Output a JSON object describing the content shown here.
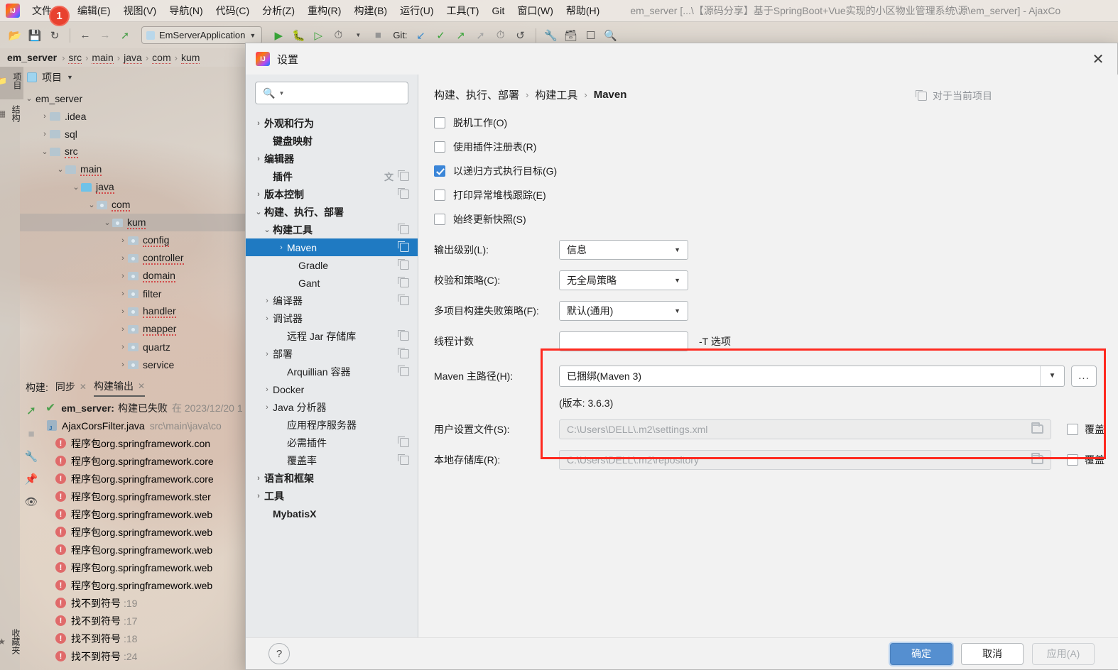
{
  "window": {
    "title": "em_server [...\\【源码分享】基于SpringBoot+Vue实现的小区物业管理系统\\源\\em_server] - AjaxCo",
    "badge": "1"
  },
  "menubar": {
    "items": [
      {
        "label": "文件(F)"
      },
      {
        "label": "编辑(E)"
      },
      {
        "label": "视图(V)"
      },
      {
        "label": "导航(N)"
      },
      {
        "label": "代码(C)"
      },
      {
        "label": "分析(Z)"
      },
      {
        "label": "重构(R)"
      },
      {
        "label": "构建(B)"
      },
      {
        "label": "运行(U)"
      },
      {
        "label": "工具(T)"
      },
      {
        "label": "Git"
      },
      {
        "label": "窗口(W)"
      },
      {
        "label": "帮助(H)"
      }
    ]
  },
  "toolbar": {
    "run_config": "EmServerApplication",
    "git_label": "Git:",
    "icons": [
      "open-icon",
      "save-icon",
      "sync-icon",
      "back-arrow-icon",
      "forward-arrow-icon",
      "build-hammer-icon"
    ],
    "run_icons": [
      "run-icon",
      "debug-icon",
      "run-with-coverage-icon",
      "profile-icon",
      "stop-icon"
    ],
    "git_icons": [
      "update-project-icon",
      "commit-icon",
      "push-icon",
      "rollback-icon",
      "history-icon",
      "undo-icon"
    ],
    "right_icons": [
      "settings-wrench-icon",
      "project-structure-icon",
      "terminal-icon",
      "search-everywhere-icon"
    ]
  },
  "breadcrumb": {
    "root": "em_server",
    "items": [
      "src",
      "main",
      "java",
      "com",
      "kum"
    ],
    "separator": "›"
  },
  "rail": {
    "tabs": [
      {
        "label": "项目",
        "glyph": "folder-icon",
        "active": true
      },
      {
        "label": "结构",
        "glyph": "structure-icon",
        "active": false
      }
    ],
    "bottom": {
      "label": "收藏夹",
      "glyph": "star-icon"
    }
  },
  "project_panel": {
    "title": "项目",
    "tree": [
      {
        "label": "em_server",
        "depth": 0,
        "arrow": "⌄",
        "icon": "none",
        "squiggle": false,
        "hl": false
      },
      {
        "label": ".idea",
        "depth": 1,
        "arrow": "›",
        "icon": "folder",
        "squiggle": false,
        "hl": false
      },
      {
        "label": "sql",
        "depth": 1,
        "arrow": "›",
        "icon": "folder",
        "squiggle": false,
        "hl": false
      },
      {
        "label": "src",
        "depth": 1,
        "arrow": "⌄",
        "icon": "folder",
        "squiggle": true,
        "hl": false
      },
      {
        "label": "main",
        "depth": 2,
        "arrow": "⌄",
        "icon": "folder",
        "squiggle": true,
        "hl": false
      },
      {
        "label": "java",
        "depth": 3,
        "arrow": "⌄",
        "icon": "folder-blue",
        "squiggle": true,
        "hl": false
      },
      {
        "label": "com",
        "depth": 4,
        "arrow": "⌄",
        "icon": "package",
        "squiggle": true,
        "hl": false
      },
      {
        "label": "kum",
        "depth": 5,
        "arrow": "⌄",
        "icon": "package",
        "squiggle": true,
        "hl": true
      },
      {
        "label": "config",
        "depth": 6,
        "arrow": "›",
        "icon": "package",
        "squiggle": true,
        "hl": false
      },
      {
        "label": "controller",
        "depth": 6,
        "arrow": "›",
        "icon": "package",
        "squiggle": true,
        "hl": false
      },
      {
        "label": "domain",
        "depth": 6,
        "arrow": "›",
        "icon": "package",
        "squiggle": true,
        "hl": false
      },
      {
        "label": "filter",
        "depth": 6,
        "arrow": "›",
        "icon": "package",
        "squiggle": false,
        "hl": false
      },
      {
        "label": "handler",
        "depth": 6,
        "arrow": "›",
        "icon": "package",
        "squiggle": true,
        "hl": false
      },
      {
        "label": "mapper",
        "depth": 6,
        "arrow": "›",
        "icon": "package",
        "squiggle": true,
        "hl": false
      },
      {
        "label": "quartz",
        "depth": 6,
        "arrow": "›",
        "icon": "package",
        "squiggle": false,
        "hl": false
      },
      {
        "label": "service",
        "depth": 6,
        "arrow": "›",
        "icon": "package",
        "squiggle": false,
        "hl": false
      }
    ]
  },
  "build_panel": {
    "label": "构建:",
    "tabs": [
      {
        "label": "同步",
        "active": false
      },
      {
        "label": "构建输出",
        "active": true
      }
    ],
    "close_glyph": "×",
    "rows": [
      {
        "type": "head",
        "icon": "build-hammer-icon",
        "text": "em_server:",
        "text2": "构建已失败",
        "dim": "在 2023/12/20 1"
      },
      {
        "type": "file",
        "icon": "java-file-icon",
        "text": "AjaxCorsFilter.java",
        "dim": "src\\main\\java\\co"
      },
      {
        "type": "err",
        "text": "程序包org.springframework.con",
        "dim": ""
      },
      {
        "type": "err",
        "text": "程序包org.springframework.core",
        "dim": ""
      },
      {
        "type": "err",
        "text": "程序包org.springframework.core",
        "dim": ""
      },
      {
        "type": "err",
        "text": "程序包org.springframework.ster",
        "dim": ""
      },
      {
        "type": "err",
        "text": "程序包org.springframework.web",
        "dim": ""
      },
      {
        "type": "err",
        "text": "程序包org.springframework.web",
        "dim": ""
      },
      {
        "type": "err",
        "text": "程序包org.springframework.web",
        "dim": ""
      },
      {
        "type": "err",
        "text": "程序包org.springframework.web",
        "dim": ""
      },
      {
        "type": "err",
        "text": "程序包org.springframework.web",
        "dim": ""
      },
      {
        "type": "err",
        "text": "找不到符号",
        "dim": ":19"
      },
      {
        "type": "err",
        "text": "找不到符号",
        "dim": ":17"
      },
      {
        "type": "err",
        "text": "找不到符号",
        "dim": ":18"
      },
      {
        "type": "err",
        "text": "找不到符号",
        "dim": ":24"
      }
    ],
    "side_icons": [
      "build-hammer-icon",
      "stop-icon",
      "settings-wrench-icon",
      "pin-icon",
      "eye-icon"
    ]
  },
  "dialog": {
    "title": "设置",
    "close_glyph": "✕",
    "search": {
      "placeholder": "",
      "value": ""
    },
    "tree": [
      {
        "label": "外观和行为",
        "depth": 0,
        "arrow": "›",
        "bold": true,
        "copy": false,
        "lang": false,
        "selected": false
      },
      {
        "label": "键盘映射",
        "depth": 1,
        "arrow": "",
        "bold": true,
        "copy": false,
        "lang": false,
        "selected": false
      },
      {
        "label": "编辑器",
        "depth": 0,
        "arrow": "›",
        "bold": true,
        "copy": false,
        "lang": false,
        "selected": false
      },
      {
        "label": "插件",
        "depth": 1,
        "arrow": "",
        "bold": true,
        "copy": true,
        "lang": true,
        "selected": false
      },
      {
        "label": "版本控制",
        "depth": 0,
        "arrow": "›",
        "bold": true,
        "copy": true,
        "lang": false,
        "selected": false
      },
      {
        "label": "构建、执行、部署",
        "depth": 0,
        "arrow": "⌄",
        "bold": true,
        "copy": false,
        "lang": false,
        "selected": false
      },
      {
        "label": "构建工具",
        "depth": 1,
        "arrow": "⌄",
        "bold": true,
        "copy": true,
        "lang": false,
        "selected": false
      },
      {
        "label": "Maven",
        "depth": 2,
        "arrow": "›",
        "bold": false,
        "copy": true,
        "lang": false,
        "selected": true
      },
      {
        "label": "Gradle",
        "depth": 3,
        "arrow": "",
        "bold": false,
        "copy": true,
        "lang": false,
        "selected": false
      },
      {
        "label": "Gant",
        "depth": 3,
        "arrow": "",
        "bold": false,
        "copy": true,
        "lang": false,
        "selected": false
      },
      {
        "label": "编译器",
        "depth": 1,
        "arrow": "›",
        "bold": false,
        "copy": true,
        "lang": false,
        "selected": false
      },
      {
        "label": "调试器",
        "depth": 1,
        "arrow": "›",
        "bold": false,
        "copy": false,
        "lang": false,
        "selected": false
      },
      {
        "label": "远程 Jar 存储库",
        "depth": 2,
        "arrow": "",
        "bold": false,
        "copy": true,
        "lang": false,
        "selected": false
      },
      {
        "label": "部署",
        "depth": 1,
        "arrow": "›",
        "bold": false,
        "copy": true,
        "lang": false,
        "selected": false
      },
      {
        "label": "Arquillian 容器",
        "depth": 2,
        "arrow": "",
        "bold": false,
        "copy": true,
        "lang": false,
        "selected": false
      },
      {
        "label": "Docker",
        "depth": 1,
        "arrow": "›",
        "bold": false,
        "copy": false,
        "lang": false,
        "selected": false
      },
      {
        "label": "Java 分析器",
        "depth": 1,
        "arrow": "›",
        "bold": false,
        "copy": false,
        "lang": false,
        "selected": false
      },
      {
        "label": "应用程序服务器",
        "depth": 2,
        "arrow": "",
        "bold": false,
        "copy": false,
        "lang": false,
        "selected": false
      },
      {
        "label": "必需插件",
        "depth": 2,
        "arrow": "",
        "bold": false,
        "copy": true,
        "lang": false,
        "selected": false
      },
      {
        "label": "覆盖率",
        "depth": 2,
        "arrow": "",
        "bold": false,
        "copy": true,
        "lang": false,
        "selected": false
      },
      {
        "label": "语言和框架",
        "depth": 0,
        "arrow": "›",
        "bold": true,
        "copy": false,
        "lang": false,
        "selected": false
      },
      {
        "label": "工具",
        "depth": 0,
        "arrow": "›",
        "bold": true,
        "copy": false,
        "lang": false,
        "selected": false
      },
      {
        "label": "MybatisX",
        "depth": 1,
        "arrow": "",
        "bold": true,
        "copy": false,
        "lang": false,
        "selected": false
      }
    ],
    "content": {
      "breadcrumb": [
        "构建、执行、部署",
        "构建工具",
        "Maven"
      ],
      "breadcrumb_sep": "›",
      "for_project": "对于当前项目",
      "checkboxes": [
        {
          "label": "脱机工作(O)",
          "checked": false
        },
        {
          "label": "使用插件注册表(R)",
          "checked": false
        },
        {
          "label": "以递归方式执行目标(G)",
          "checked": true
        },
        {
          "label": "打印异常堆栈跟踪(E)",
          "checked": false
        },
        {
          "label": "始终更新快照(S)",
          "checked": false
        }
      ],
      "fields": [
        {
          "label": "输出级别(L):",
          "value": "信息",
          "type": "combo"
        },
        {
          "label": "校验和策略(C):",
          "value": "无全局策略",
          "type": "combo"
        },
        {
          "label": "多项目构建失败策略(F):",
          "value": "默认(通用)",
          "type": "combo"
        },
        {
          "label": "线程计数",
          "value": "",
          "type": "text",
          "suffix": "-T 选项"
        }
      ],
      "maven_home": {
        "label": "Maven 主路径(H):",
        "value": "已捆绑(Maven 3)",
        "dots": "...",
        "version": "(版本: 3.6.3)"
      },
      "user_settings": {
        "label": "用户设置文件(S):",
        "value": "C:\\Users\\DELL\\.m2\\settings.xml",
        "override_label": "覆盖",
        "override_checked": false
      },
      "local_repo": {
        "label": "本地存储库(R):",
        "value": "C:\\Users\\DELL\\.m2\\repository",
        "override_label": "覆盖",
        "override_checked": false
      }
    },
    "footer": {
      "help": "?",
      "ok": "确定",
      "cancel": "取消",
      "apply": "应用(A)"
    }
  },
  "colors": {
    "accent_blue": "#1f7ac2",
    "primary_button": "#558fd0",
    "highlight_red": "#ff2a20",
    "error_red": "#e06a6a",
    "badge_red": "#e8412f"
  }
}
